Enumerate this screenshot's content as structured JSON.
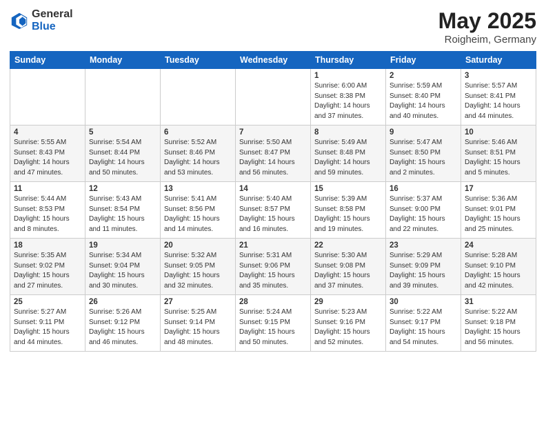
{
  "logo": {
    "general": "General",
    "blue": "Blue"
  },
  "title": "May 2025",
  "subtitle": "Roigheim, Germany",
  "days_header": [
    "Sunday",
    "Monday",
    "Tuesday",
    "Wednesday",
    "Thursday",
    "Friday",
    "Saturday"
  ],
  "weeks": [
    [
      {
        "day": "",
        "info": ""
      },
      {
        "day": "",
        "info": ""
      },
      {
        "day": "",
        "info": ""
      },
      {
        "day": "",
        "info": ""
      },
      {
        "day": "1",
        "info": "Sunrise: 6:00 AM\nSunset: 8:38 PM\nDaylight: 14 hours\nand 37 minutes."
      },
      {
        "day": "2",
        "info": "Sunrise: 5:59 AM\nSunset: 8:40 PM\nDaylight: 14 hours\nand 40 minutes."
      },
      {
        "day": "3",
        "info": "Sunrise: 5:57 AM\nSunset: 8:41 PM\nDaylight: 14 hours\nand 44 minutes."
      }
    ],
    [
      {
        "day": "4",
        "info": "Sunrise: 5:55 AM\nSunset: 8:43 PM\nDaylight: 14 hours\nand 47 minutes."
      },
      {
        "day": "5",
        "info": "Sunrise: 5:54 AM\nSunset: 8:44 PM\nDaylight: 14 hours\nand 50 minutes."
      },
      {
        "day": "6",
        "info": "Sunrise: 5:52 AM\nSunset: 8:46 PM\nDaylight: 14 hours\nand 53 minutes."
      },
      {
        "day": "7",
        "info": "Sunrise: 5:50 AM\nSunset: 8:47 PM\nDaylight: 14 hours\nand 56 minutes."
      },
      {
        "day": "8",
        "info": "Sunrise: 5:49 AM\nSunset: 8:48 PM\nDaylight: 14 hours\nand 59 minutes."
      },
      {
        "day": "9",
        "info": "Sunrise: 5:47 AM\nSunset: 8:50 PM\nDaylight: 15 hours\nand 2 minutes."
      },
      {
        "day": "10",
        "info": "Sunrise: 5:46 AM\nSunset: 8:51 PM\nDaylight: 15 hours\nand 5 minutes."
      }
    ],
    [
      {
        "day": "11",
        "info": "Sunrise: 5:44 AM\nSunset: 8:53 PM\nDaylight: 15 hours\nand 8 minutes."
      },
      {
        "day": "12",
        "info": "Sunrise: 5:43 AM\nSunset: 8:54 PM\nDaylight: 15 hours\nand 11 minutes."
      },
      {
        "day": "13",
        "info": "Sunrise: 5:41 AM\nSunset: 8:56 PM\nDaylight: 15 hours\nand 14 minutes."
      },
      {
        "day": "14",
        "info": "Sunrise: 5:40 AM\nSunset: 8:57 PM\nDaylight: 15 hours\nand 16 minutes."
      },
      {
        "day": "15",
        "info": "Sunrise: 5:39 AM\nSunset: 8:58 PM\nDaylight: 15 hours\nand 19 minutes."
      },
      {
        "day": "16",
        "info": "Sunrise: 5:37 AM\nSunset: 9:00 PM\nDaylight: 15 hours\nand 22 minutes."
      },
      {
        "day": "17",
        "info": "Sunrise: 5:36 AM\nSunset: 9:01 PM\nDaylight: 15 hours\nand 25 minutes."
      }
    ],
    [
      {
        "day": "18",
        "info": "Sunrise: 5:35 AM\nSunset: 9:02 PM\nDaylight: 15 hours\nand 27 minutes."
      },
      {
        "day": "19",
        "info": "Sunrise: 5:34 AM\nSunset: 9:04 PM\nDaylight: 15 hours\nand 30 minutes."
      },
      {
        "day": "20",
        "info": "Sunrise: 5:32 AM\nSunset: 9:05 PM\nDaylight: 15 hours\nand 32 minutes."
      },
      {
        "day": "21",
        "info": "Sunrise: 5:31 AM\nSunset: 9:06 PM\nDaylight: 15 hours\nand 35 minutes."
      },
      {
        "day": "22",
        "info": "Sunrise: 5:30 AM\nSunset: 9:08 PM\nDaylight: 15 hours\nand 37 minutes."
      },
      {
        "day": "23",
        "info": "Sunrise: 5:29 AM\nSunset: 9:09 PM\nDaylight: 15 hours\nand 39 minutes."
      },
      {
        "day": "24",
        "info": "Sunrise: 5:28 AM\nSunset: 9:10 PM\nDaylight: 15 hours\nand 42 minutes."
      }
    ],
    [
      {
        "day": "25",
        "info": "Sunrise: 5:27 AM\nSunset: 9:11 PM\nDaylight: 15 hours\nand 44 minutes."
      },
      {
        "day": "26",
        "info": "Sunrise: 5:26 AM\nSunset: 9:12 PM\nDaylight: 15 hours\nand 46 minutes."
      },
      {
        "day": "27",
        "info": "Sunrise: 5:25 AM\nSunset: 9:14 PM\nDaylight: 15 hours\nand 48 minutes."
      },
      {
        "day": "28",
        "info": "Sunrise: 5:24 AM\nSunset: 9:15 PM\nDaylight: 15 hours\nand 50 minutes."
      },
      {
        "day": "29",
        "info": "Sunrise: 5:23 AM\nSunset: 9:16 PM\nDaylight: 15 hours\nand 52 minutes."
      },
      {
        "day": "30",
        "info": "Sunrise: 5:22 AM\nSunset: 9:17 PM\nDaylight: 15 hours\nand 54 minutes."
      },
      {
        "day": "31",
        "info": "Sunrise: 5:22 AM\nSunset: 9:18 PM\nDaylight: 15 hours\nand 56 minutes."
      }
    ]
  ]
}
